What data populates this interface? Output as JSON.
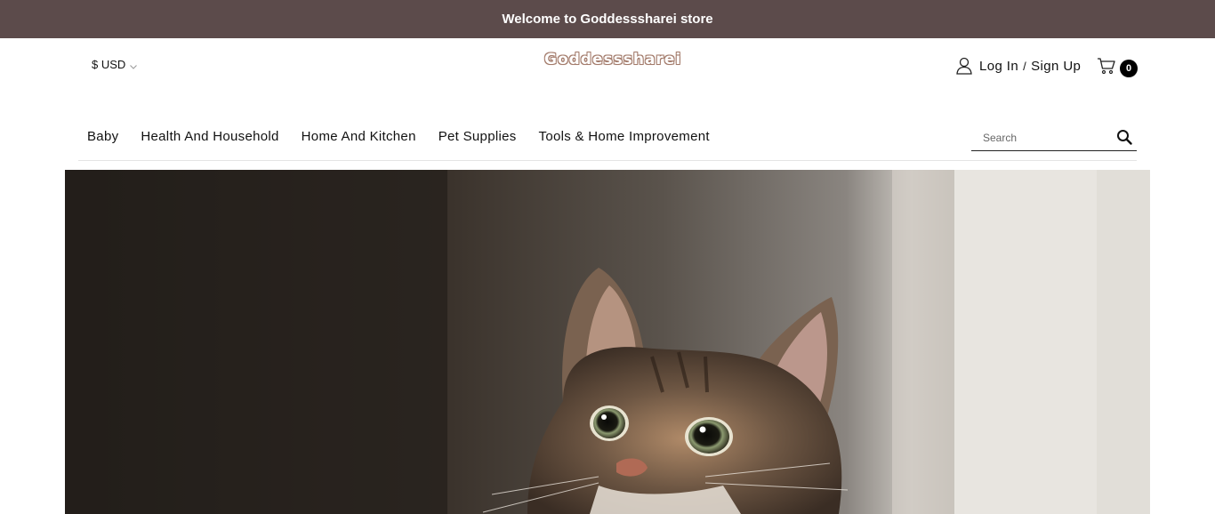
{
  "announcement": "Welcome to Goddesssharei store",
  "currency": {
    "label": "$ USD"
  },
  "logo": {
    "text": "Goddesssharei"
  },
  "account": {
    "login_label": "Log In",
    "separator": "/",
    "signup_label": "Sign Up"
  },
  "cart": {
    "count": "0"
  },
  "nav": {
    "items": [
      {
        "label": "Baby"
      },
      {
        "label": "Health And Household"
      },
      {
        "label": "Home And Kitchen"
      },
      {
        "label": "Pet Supplies"
      },
      {
        "label": "Tools & Home Improvement"
      }
    ]
  },
  "search": {
    "placeholder": "Search"
  },
  "icons": {
    "user": "user-icon",
    "cart": "cart-icon",
    "search": "search-icon",
    "chevron": "chevron-down-icon"
  },
  "colors": {
    "announcement_bg": "#5c4b4b",
    "logo_outline": "#a27a6a"
  }
}
